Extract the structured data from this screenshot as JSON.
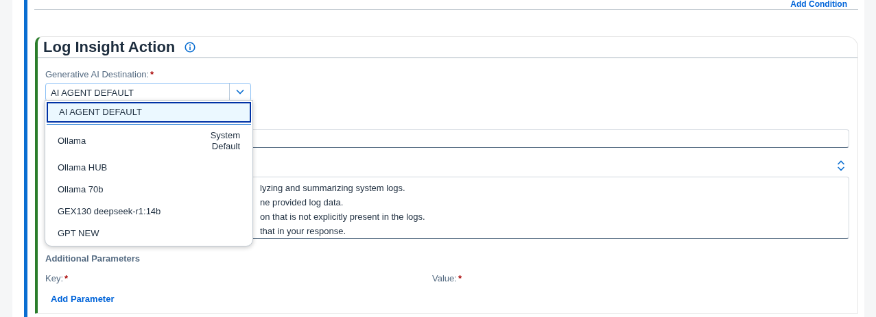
{
  "top_link": "Add Condition",
  "section": {
    "title": "Log Insight Action",
    "destination": {
      "label": "Generative AI Destination:",
      "required_mark": "*",
      "value": "AI AGENT DEFAULT",
      "expanded": true,
      "options": [
        {
          "label": "AI AGENT DEFAULT",
          "selected": true
        },
        {
          "label": "Ollama",
          "note": "System Default",
          "selected": false
        },
        {
          "label": "Ollama HUB",
          "selected": false
        },
        {
          "label": "Ollama 70b",
          "selected": false
        },
        {
          "label": "GEX130 deepseek-r1:14b",
          "selected": false
        },
        {
          "label": "GPT NEW",
          "selected": false
        }
      ]
    },
    "prompt_lines": [
      "lyzing and summarizing system logs.",
      "ne provided log data.",
      "on that is not explicitly present in the logs.",
      "that in your response."
    ],
    "additional_parameters": {
      "title": "Additional Parameters",
      "key_label": "Key:",
      "value_label": "Value:",
      "required_mark": "*",
      "add_link": "Add Parameter"
    }
  }
}
